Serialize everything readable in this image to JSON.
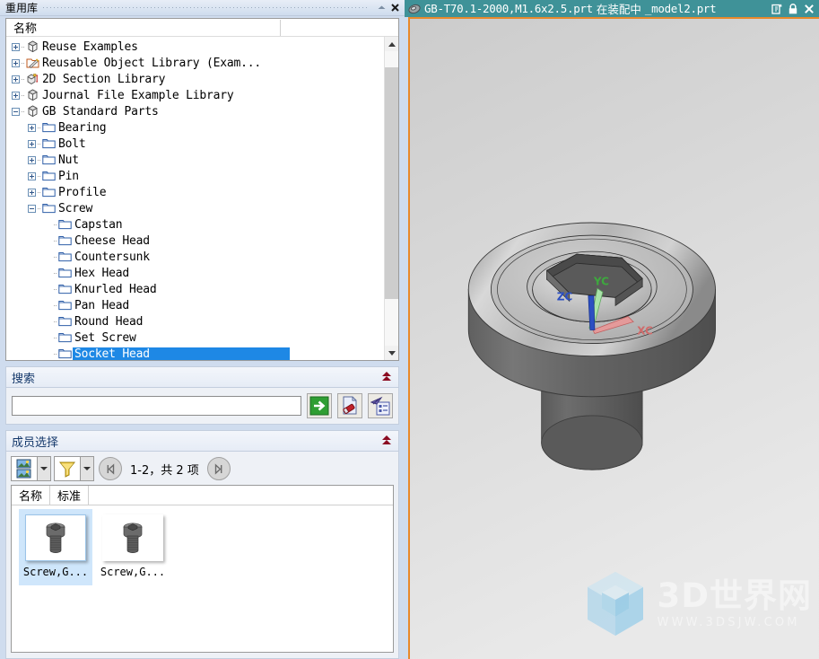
{
  "left_panel": {
    "title": "重用库",
    "titlebar_buttons": [
      {
        "name": "collapse-pin-icon",
        "glyph": "▲"
      },
      {
        "name": "close-icon",
        "glyph": "✕"
      }
    ],
    "tree": {
      "column_header": "名称",
      "nodes": [
        {
          "label": "Reuse Examples",
          "depth": 0,
          "expander": "plus",
          "icon": "cube-icon"
        },
        {
          "label": "Reusable Object Library (Exam...",
          "depth": 0,
          "expander": "plus",
          "icon": "folder-pencil-icon"
        },
        {
          "label": "2D Section Library",
          "depth": 0,
          "expander": "plus",
          "icon": "section-icon"
        },
        {
          "label": "Journal File Example Library",
          "depth": 0,
          "expander": "plus",
          "icon": "cube-icon"
        },
        {
          "label": "GB Standard Parts",
          "depth": 0,
          "expander": "minus",
          "icon": "cube-icon"
        },
        {
          "label": "Bearing",
          "depth": 1,
          "expander": "plus",
          "icon": "folder-icon"
        },
        {
          "label": "Bolt",
          "depth": 1,
          "expander": "plus",
          "icon": "folder-icon"
        },
        {
          "label": "Nut",
          "depth": 1,
          "expander": "plus",
          "icon": "folder-icon"
        },
        {
          "label": "Pin",
          "depth": 1,
          "expander": "plus",
          "icon": "folder-icon"
        },
        {
          "label": "Profile",
          "depth": 1,
          "expander": "plus",
          "icon": "folder-icon"
        },
        {
          "label": "Screw",
          "depth": 1,
          "expander": "minus",
          "icon": "folder-icon"
        },
        {
          "label": "Capstan",
          "depth": 2,
          "expander": "none",
          "icon": "folder-icon"
        },
        {
          "label": "Cheese Head",
          "depth": 2,
          "expander": "none",
          "icon": "folder-icon"
        },
        {
          "label": "Countersunk",
          "depth": 2,
          "expander": "none",
          "icon": "folder-icon"
        },
        {
          "label": "Hex Head",
          "depth": 2,
          "expander": "none",
          "icon": "folder-icon"
        },
        {
          "label": "Knurled Head",
          "depth": 2,
          "expander": "none",
          "icon": "folder-icon"
        },
        {
          "label": "Pan Head",
          "depth": 2,
          "expander": "none",
          "icon": "folder-icon"
        },
        {
          "label": "Round Head",
          "depth": 2,
          "expander": "none",
          "icon": "folder-icon"
        },
        {
          "label": "Set Screw",
          "depth": 2,
          "expander": "none",
          "icon": "folder-icon"
        },
        {
          "label": "Socket Head",
          "depth": 2,
          "expander": "none",
          "icon": "folder-icon",
          "selected": true
        }
      ]
    },
    "search": {
      "title": "搜索",
      "input_value": "",
      "input_placeholder": "",
      "buttons": [
        {
          "name": "search-go-button",
          "icon": "green-arrow-right-icon"
        },
        {
          "name": "clear-search-button",
          "icon": "erase-document-icon"
        },
        {
          "name": "advanced-search-button",
          "icon": "filter-list-icon"
        }
      ]
    },
    "member_selection": {
      "title": "成员选择",
      "view_mode_button": "thumbnail-view-icon",
      "filter_button": "filter-funnel-icon",
      "prev_page_button": "first-page-icon",
      "next_page_button": "last-page-icon",
      "page_info": "1-2，共 2 项",
      "columns": [
        "名称",
        "标准"
      ],
      "items": [
        {
          "label": "Screw,G...",
          "selected": true
        },
        {
          "label": "Screw,G...",
          "selected": false
        }
      ]
    }
  },
  "graphics_window": {
    "title_part": "GB-T70.1-2000,M1.6x2.5.prt",
    "title_status": "在装配中",
    "title_assembly": "_model2.prt",
    "titlebar_buttons": [
      {
        "name": "restore-window-icon",
        "glyph": "⧉"
      },
      {
        "name": "lock-icon",
        "glyph": "🔒"
      },
      {
        "name": "close-window-icon",
        "glyph": "✕"
      }
    ],
    "wcs_labels": {
      "x": "XC",
      "y": "YC",
      "z": "ZC"
    },
    "colors": {
      "titlebar": "#3f9298",
      "viewport_border": "#e8892b",
      "viewport_bg": "#c9c9c9",
      "axis_x": "#e06666",
      "axis_y": "#4caf50",
      "axis_z": "#2b4fc2"
    },
    "watermark": {
      "main": "3D世界网",
      "sub": "WWW.3DSJW.COM"
    }
  }
}
